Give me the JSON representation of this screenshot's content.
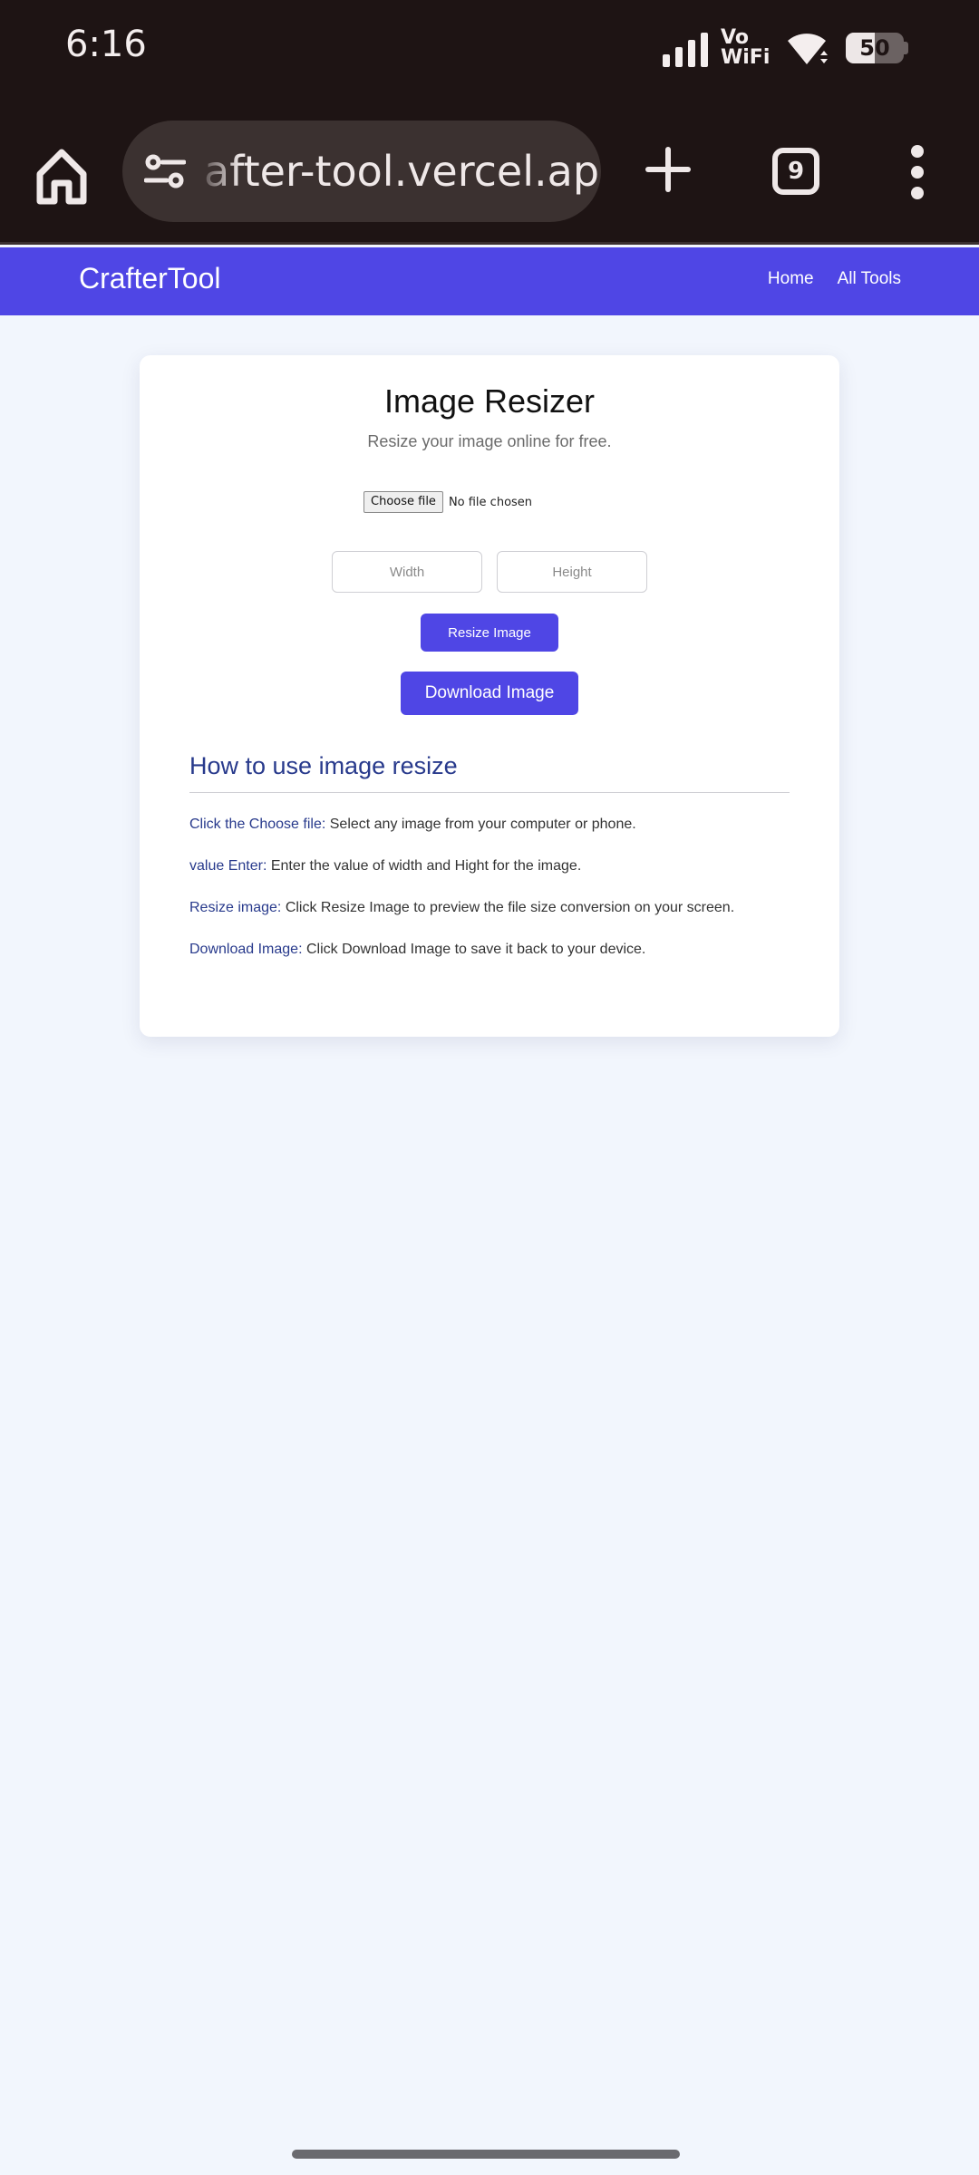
{
  "status_bar": {
    "time": "6:16",
    "network_label_top": "Vo",
    "network_label_bottom": "WiFi",
    "battery_level": "50",
    "battery_fraction": 0.5,
    "icons": [
      "signal-icon",
      "vowifi-icon",
      "wifi-icon",
      "battery-icon"
    ]
  },
  "browser": {
    "url_text": "after-tool.vercel.app",
    "tab_count": "9",
    "icons": [
      "home-icon",
      "site-settings-icon",
      "plus-icon",
      "tab-switcher-icon",
      "overflow-menu-icon"
    ]
  },
  "site_nav": {
    "logo": "CrafterTool",
    "links": [
      "Home",
      "All Tools"
    ]
  },
  "card": {
    "title": "Image Resizer",
    "subtitle": "Resize your image online for free.",
    "file_button": "Choose file",
    "file_status": "No file chosen",
    "width_placeholder": "Width",
    "height_placeholder": "Height",
    "resize_button": "Resize Image",
    "download_button": "Download Image",
    "howto_title": "How to use image resize",
    "steps": [
      {
        "key": "Click the Choose file:",
        "text": " Select any image from your computer or phone."
      },
      {
        "key": "value Enter:",
        "text": " Enter the value of width and Hight for the image."
      },
      {
        "key": "Resize image:",
        "text": " Click Resize Image to preview the file size conversion on your screen."
      },
      {
        "key": "Download Image:",
        "text": " Click Download Image to save it back to your device."
      }
    ]
  },
  "colors": {
    "status_bar_bg": "#1e1414",
    "brand": "#4f46e5",
    "page_bg": "#f2f6fd",
    "heading_blue": "#283a8c"
  }
}
